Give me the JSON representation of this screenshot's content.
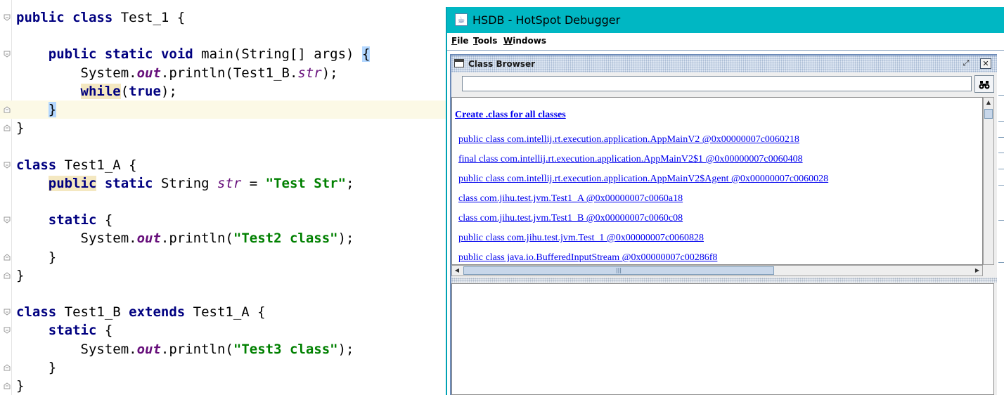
{
  "editor": {
    "lines": [
      {
        "parts": [
          {
            "t": "public",
            "c": "kw"
          },
          {
            "t": " "
          },
          {
            "t": "class",
            "c": "kw"
          },
          {
            "t": " Test_1 {"
          }
        ]
      },
      {
        "parts": []
      },
      {
        "parts": [
          {
            "t": "    "
          },
          {
            "t": "public",
            "c": "kw"
          },
          {
            "t": " "
          },
          {
            "t": "static",
            "c": "kw"
          },
          {
            "t": " "
          },
          {
            "t": "void",
            "c": "kw"
          },
          {
            "t": " main(String[] args) "
          },
          {
            "t": "{",
            "c": "br"
          }
        ]
      },
      {
        "parts": [
          {
            "t": "        System."
          },
          {
            "t": "out",
            "c": "fldb"
          },
          {
            "t": ".println(Test1_B."
          },
          {
            "t": "str",
            "c": "fld"
          },
          {
            "t": ");"
          }
        ]
      },
      {
        "parts": [
          {
            "t": "        "
          },
          {
            "t": "while",
            "c": "kw hl"
          },
          {
            "t": "("
          },
          {
            "t": "true",
            "c": "kw"
          },
          {
            "t": ");"
          }
        ]
      },
      {
        "parts": [
          {
            "t": "    "
          },
          {
            "t": "}",
            "c": "br"
          }
        ],
        "current": true
      },
      {
        "parts": [
          {
            "t": "}"
          }
        ]
      },
      {
        "parts": []
      },
      {
        "parts": [
          {
            "t": "class",
            "c": "kw"
          },
          {
            "t": " Test1_A {"
          }
        ]
      },
      {
        "parts": [
          {
            "t": "    "
          },
          {
            "t": "public",
            "c": "kw hl"
          },
          {
            "t": " "
          },
          {
            "t": "static",
            "c": "kw"
          },
          {
            "t": " String "
          },
          {
            "t": "str",
            "c": "fld"
          },
          {
            "t": " = "
          },
          {
            "t": "\"Test Str\"",
            "c": "str"
          },
          {
            "t": ";"
          }
        ]
      },
      {
        "parts": []
      },
      {
        "parts": [
          {
            "t": "    "
          },
          {
            "t": "static",
            "c": "kw"
          },
          {
            "t": " {"
          }
        ]
      },
      {
        "parts": [
          {
            "t": "        System."
          },
          {
            "t": "out",
            "c": "fldb"
          },
          {
            "t": ".println("
          },
          {
            "t": "\"Test2 class\"",
            "c": "str"
          },
          {
            "t": ");"
          }
        ]
      },
      {
        "parts": [
          {
            "t": "    }"
          }
        ]
      },
      {
        "parts": [
          {
            "t": "}"
          }
        ]
      },
      {
        "parts": []
      },
      {
        "parts": [
          {
            "t": "class",
            "c": "kw"
          },
          {
            "t": " Test1_B "
          },
          {
            "t": "extends",
            "c": "kw"
          },
          {
            "t": " Test1_A {"
          }
        ]
      },
      {
        "parts": [
          {
            "t": "    "
          },
          {
            "t": "static",
            "c": "kw"
          },
          {
            "t": " {"
          }
        ]
      },
      {
        "parts": [
          {
            "t": "        System."
          },
          {
            "t": "out",
            "c": "fldb"
          },
          {
            "t": ".println("
          },
          {
            "t": "\"Test3 class\"",
            "c": "str"
          },
          {
            "t": ");"
          }
        ]
      },
      {
        "parts": [
          {
            "t": "    }"
          }
        ]
      },
      {
        "parts": [
          {
            "t": "}"
          }
        ]
      }
    ],
    "fold_markers": [
      {
        "line": 0,
        "type": "open"
      },
      {
        "line": 2,
        "type": "open"
      },
      {
        "line": 5,
        "type": "close"
      },
      {
        "line": 6,
        "type": "close"
      },
      {
        "line": 8,
        "type": "open"
      },
      {
        "line": 11,
        "type": "open"
      },
      {
        "line": 13,
        "type": "close"
      },
      {
        "line": 14,
        "type": "close"
      },
      {
        "line": 16,
        "type": "open"
      },
      {
        "line": 17,
        "type": "open"
      },
      {
        "line": 19,
        "type": "close"
      },
      {
        "line": 20,
        "type": "close"
      }
    ]
  },
  "hsdb": {
    "title": "HSDB - HotSpot Debugger",
    "menu": [
      "File",
      "Tools",
      "Windows"
    ],
    "class_browser": {
      "title": "Class Browser",
      "search_value": "",
      "find_icon": "binoculars-icon",
      "create_link": "Create .class for all classes",
      "classes": [
        "public class com.intellij.rt.execution.application.AppMainV2 @0x00000007c0060218",
        "final class com.intellij.rt.execution.application.AppMainV2$1 @0x00000007c0060408",
        "public class com.intellij.rt.execution.application.AppMainV2$Agent @0x00000007c0060028",
        "class com.jihu.test.jvm.Test1_A @0x00000007c0060a18",
        "class com.jihu.test.jvm.Test1_B @0x00000007c0060c08",
        "public class com.jihu.test.jvm.Test_1 @0x00000007c0060828",
        "public class java.io.BufferedInputStream @0x00000007c00286f8"
      ]
    }
  },
  "colors": {
    "keyword": "#000080",
    "field": "#660e7a",
    "string": "#008000",
    "titlebar": "#00b7c3",
    "link": "#0000ee"
  }
}
